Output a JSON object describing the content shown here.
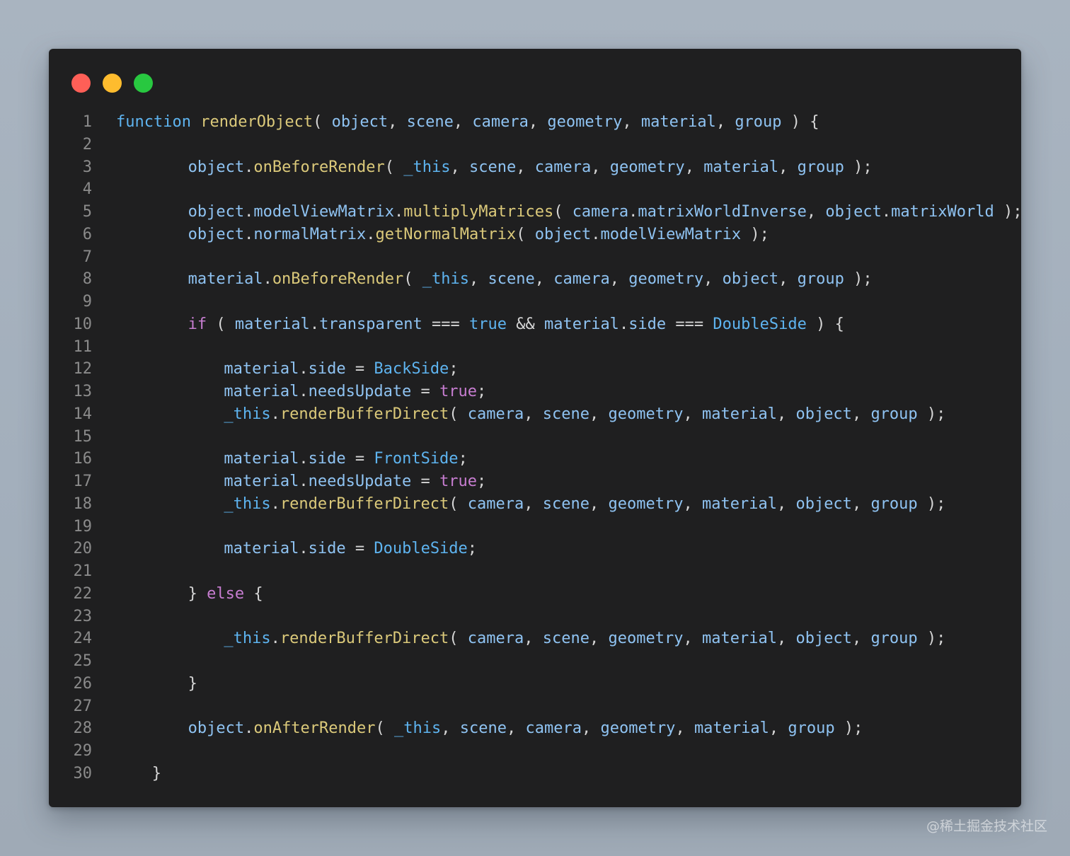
{
  "window": {
    "controls": {
      "close_color": "#fe5f57",
      "minimize_color": "#febc2e",
      "maximize_color": "#28c840"
    }
  },
  "watermark": "@稀土掘金技术社区",
  "colors": {
    "background": "#a3afbc",
    "editor": "#1f1f20",
    "keyword": "#c77dd1",
    "builtin": "#5eb4f0",
    "function": "#dbc97a",
    "variable": "#8fc3f2",
    "punctuation": "#d6d6d6",
    "line_number": "#8b8b8b"
  },
  "code_lines": [
    {
      "n": "1",
      "indent": 0,
      "tokens": [
        [
          "b",
          "function"
        ],
        [
          "p",
          " "
        ],
        [
          "y",
          "renderObject"
        ],
        [
          "p",
          "( "
        ],
        [
          "v",
          "object"
        ],
        [
          "p",
          ", "
        ],
        [
          "v",
          "scene"
        ],
        [
          "p",
          ", "
        ],
        [
          "v",
          "camera"
        ],
        [
          "p",
          ", "
        ],
        [
          "v",
          "geometry"
        ],
        [
          "p",
          ", "
        ],
        [
          "v",
          "material"
        ],
        [
          "p",
          ", "
        ],
        [
          "v",
          "group"
        ],
        [
          "p",
          " ) {"
        ]
      ]
    },
    {
      "n": "2",
      "indent": 0,
      "tokens": []
    },
    {
      "n": "3",
      "indent": 8,
      "tokens": [
        [
          "v",
          "object"
        ],
        [
          "p",
          "."
        ],
        [
          "y",
          "onBeforeRender"
        ],
        [
          "p",
          "( "
        ],
        [
          "b",
          "_this"
        ],
        [
          "p",
          ", "
        ],
        [
          "v",
          "scene"
        ],
        [
          "p",
          ", "
        ],
        [
          "v",
          "camera"
        ],
        [
          "p",
          ", "
        ],
        [
          "v",
          "geometry"
        ],
        [
          "p",
          ", "
        ],
        [
          "v",
          "material"
        ],
        [
          "p",
          ", "
        ],
        [
          "v",
          "group"
        ],
        [
          "p",
          " );"
        ]
      ]
    },
    {
      "n": "4",
      "indent": 0,
      "tokens": []
    },
    {
      "n": "5",
      "indent": 8,
      "tokens": [
        [
          "v",
          "object"
        ],
        [
          "p",
          "."
        ],
        [
          "v",
          "modelViewMatrix"
        ],
        [
          "p",
          "."
        ],
        [
          "y",
          "multiplyMatrices"
        ],
        [
          "p",
          "( "
        ],
        [
          "v",
          "camera"
        ],
        [
          "p",
          "."
        ],
        [
          "v",
          "matrixWorldInverse"
        ],
        [
          "p",
          ", "
        ],
        [
          "v",
          "object"
        ],
        [
          "p",
          "."
        ],
        [
          "v",
          "matrixWorld"
        ],
        [
          "p",
          " );"
        ]
      ]
    },
    {
      "n": "6",
      "indent": 8,
      "tokens": [
        [
          "v",
          "object"
        ],
        [
          "p",
          "."
        ],
        [
          "v",
          "normalMatrix"
        ],
        [
          "p",
          "."
        ],
        [
          "y",
          "getNormalMatrix"
        ],
        [
          "p",
          "( "
        ],
        [
          "v",
          "object"
        ],
        [
          "p",
          "."
        ],
        [
          "v",
          "modelViewMatrix"
        ],
        [
          "p",
          " );"
        ]
      ]
    },
    {
      "n": "7",
      "indent": 0,
      "tokens": []
    },
    {
      "n": "8",
      "indent": 8,
      "tokens": [
        [
          "v",
          "material"
        ],
        [
          "p",
          "."
        ],
        [
          "y",
          "onBeforeRender"
        ],
        [
          "p",
          "( "
        ],
        [
          "b",
          "_this"
        ],
        [
          "p",
          ", "
        ],
        [
          "v",
          "scene"
        ],
        [
          "p",
          ", "
        ],
        [
          "v",
          "camera"
        ],
        [
          "p",
          ", "
        ],
        [
          "v",
          "geometry"
        ],
        [
          "p",
          ", "
        ],
        [
          "v",
          "object"
        ],
        [
          "p",
          ", "
        ],
        [
          "v",
          "group"
        ],
        [
          "p",
          " );"
        ]
      ]
    },
    {
      "n": "9",
      "indent": 0,
      "tokens": []
    },
    {
      "n": "10",
      "indent": 8,
      "tokens": [
        [
          "k",
          "if"
        ],
        [
          "p",
          " ( "
        ],
        [
          "v",
          "material"
        ],
        [
          "p",
          "."
        ],
        [
          "v",
          "transparent"
        ],
        [
          "p",
          " === "
        ],
        [
          "b",
          "true"
        ],
        [
          "p",
          " && "
        ],
        [
          "v",
          "material"
        ],
        [
          "p",
          "."
        ],
        [
          "v",
          "side"
        ],
        [
          "p",
          " === "
        ],
        [
          "b",
          "DoubleSide"
        ],
        [
          "p",
          " ) {"
        ]
      ]
    },
    {
      "n": "11",
      "indent": 0,
      "tokens": []
    },
    {
      "n": "12",
      "indent": 12,
      "tokens": [
        [
          "v",
          "material"
        ],
        [
          "p",
          "."
        ],
        [
          "v",
          "side"
        ],
        [
          "p",
          " = "
        ],
        [
          "b",
          "BackSide"
        ],
        [
          "p",
          ";"
        ]
      ]
    },
    {
      "n": "13",
      "indent": 12,
      "tokens": [
        [
          "v",
          "material"
        ],
        [
          "p",
          "."
        ],
        [
          "v",
          "needsUpdate"
        ],
        [
          "p",
          " = "
        ],
        [
          "k",
          "true"
        ],
        [
          "p",
          ";"
        ]
      ]
    },
    {
      "n": "14",
      "indent": 12,
      "tokens": [
        [
          "b",
          "_this"
        ],
        [
          "p",
          "."
        ],
        [
          "y",
          "renderBufferDirect"
        ],
        [
          "p",
          "( "
        ],
        [
          "v",
          "camera"
        ],
        [
          "p",
          ", "
        ],
        [
          "v",
          "scene"
        ],
        [
          "p",
          ", "
        ],
        [
          "v",
          "geometry"
        ],
        [
          "p",
          ", "
        ],
        [
          "v",
          "material"
        ],
        [
          "p",
          ", "
        ],
        [
          "v",
          "object"
        ],
        [
          "p",
          ", "
        ],
        [
          "v",
          "group"
        ],
        [
          "p",
          " );"
        ]
      ]
    },
    {
      "n": "15",
      "indent": 0,
      "tokens": []
    },
    {
      "n": "16",
      "indent": 12,
      "tokens": [
        [
          "v",
          "material"
        ],
        [
          "p",
          "."
        ],
        [
          "v",
          "side"
        ],
        [
          "p",
          " = "
        ],
        [
          "b",
          "FrontSide"
        ],
        [
          "p",
          ";"
        ]
      ]
    },
    {
      "n": "17",
      "indent": 12,
      "tokens": [
        [
          "v",
          "material"
        ],
        [
          "p",
          "."
        ],
        [
          "v",
          "needsUpdate"
        ],
        [
          "p",
          " = "
        ],
        [
          "k",
          "true"
        ],
        [
          "p",
          ";"
        ]
      ]
    },
    {
      "n": "18",
      "indent": 12,
      "tokens": [
        [
          "b",
          "_this"
        ],
        [
          "p",
          "."
        ],
        [
          "y",
          "renderBufferDirect"
        ],
        [
          "p",
          "( "
        ],
        [
          "v",
          "camera"
        ],
        [
          "p",
          ", "
        ],
        [
          "v",
          "scene"
        ],
        [
          "p",
          ", "
        ],
        [
          "v",
          "geometry"
        ],
        [
          "p",
          ", "
        ],
        [
          "v",
          "material"
        ],
        [
          "p",
          ", "
        ],
        [
          "v",
          "object"
        ],
        [
          "p",
          ", "
        ],
        [
          "v",
          "group"
        ],
        [
          "p",
          " );"
        ]
      ]
    },
    {
      "n": "19",
      "indent": 0,
      "tokens": []
    },
    {
      "n": "20",
      "indent": 12,
      "tokens": [
        [
          "v",
          "material"
        ],
        [
          "p",
          "."
        ],
        [
          "v",
          "side"
        ],
        [
          "p",
          " = "
        ],
        [
          "b",
          "DoubleSide"
        ],
        [
          "p",
          ";"
        ]
      ]
    },
    {
      "n": "21",
      "indent": 0,
      "tokens": []
    },
    {
      "n": "22",
      "indent": 8,
      "tokens": [
        [
          "p",
          "} "
        ],
        [
          "k",
          "else"
        ],
        [
          "p",
          " {"
        ]
      ]
    },
    {
      "n": "23",
      "indent": 0,
      "tokens": []
    },
    {
      "n": "24",
      "indent": 12,
      "tokens": [
        [
          "b",
          "_this"
        ],
        [
          "p",
          "."
        ],
        [
          "y",
          "renderBufferDirect"
        ],
        [
          "p",
          "( "
        ],
        [
          "v",
          "camera"
        ],
        [
          "p",
          ", "
        ],
        [
          "v",
          "scene"
        ],
        [
          "p",
          ", "
        ],
        [
          "v",
          "geometry"
        ],
        [
          "p",
          ", "
        ],
        [
          "v",
          "material"
        ],
        [
          "p",
          ", "
        ],
        [
          "v",
          "object"
        ],
        [
          "p",
          ", "
        ],
        [
          "v",
          "group"
        ],
        [
          "p",
          " );"
        ]
      ]
    },
    {
      "n": "25",
      "indent": 0,
      "tokens": []
    },
    {
      "n": "26",
      "indent": 8,
      "tokens": [
        [
          "p",
          "}"
        ]
      ]
    },
    {
      "n": "27",
      "indent": 0,
      "tokens": []
    },
    {
      "n": "28",
      "indent": 8,
      "tokens": [
        [
          "v",
          "object"
        ],
        [
          "p",
          "."
        ],
        [
          "y",
          "onAfterRender"
        ],
        [
          "p",
          "( "
        ],
        [
          "b",
          "_this"
        ],
        [
          "p",
          ", "
        ],
        [
          "v",
          "scene"
        ],
        [
          "p",
          ", "
        ],
        [
          "v",
          "camera"
        ],
        [
          "p",
          ", "
        ],
        [
          "v",
          "geometry"
        ],
        [
          "p",
          ", "
        ],
        [
          "v",
          "material"
        ],
        [
          "p",
          ", "
        ],
        [
          "v",
          "group"
        ],
        [
          "p",
          " );"
        ]
      ]
    },
    {
      "n": "29",
      "indent": 0,
      "tokens": []
    },
    {
      "n": "30",
      "indent": 4,
      "tokens": [
        [
          "p",
          "}"
        ]
      ]
    }
  ]
}
